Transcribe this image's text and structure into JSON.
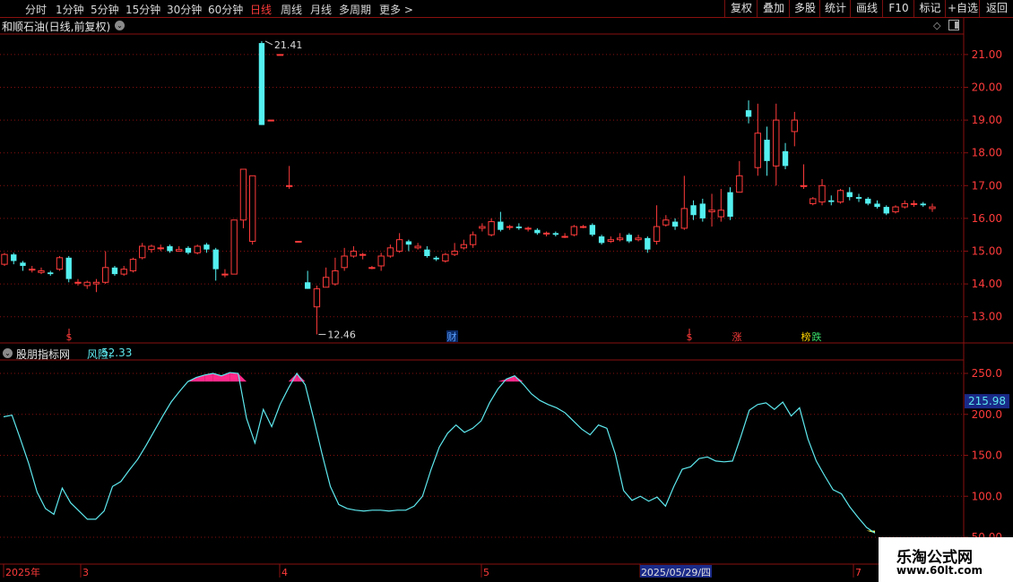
{
  "toolbar": {
    "timeframes": [
      {
        "label": "分时"
      },
      {
        "label": "1分钟"
      },
      {
        "label": "5分钟"
      },
      {
        "label": "15分钟"
      },
      {
        "label": "30分钟"
      },
      {
        "label": "60分钟"
      },
      {
        "label": "日线",
        "active": true
      },
      {
        "label": "周线"
      },
      {
        "label": "月线"
      },
      {
        "label": "多周期"
      },
      {
        "label": "更多 >"
      }
    ],
    "right_buttons": [
      {
        "label": "复权"
      },
      {
        "label": "叠加"
      },
      {
        "label": "多股"
      },
      {
        "label": "统计"
      },
      {
        "label": "画线"
      },
      {
        "label": "F10"
      },
      {
        "label": "标记"
      },
      {
        "label": "+自选"
      },
      {
        "label": "返回"
      }
    ]
  },
  "stock": {
    "title": "和顺石油(日线,前复权)"
  },
  "price_axis": {
    "labels": [
      "21.00",
      "20.00",
      "19.00",
      "18.00",
      "17.00",
      "16.00",
      "15.00",
      "14.00",
      "13.00"
    ]
  },
  "annotations": {
    "high": "21.41",
    "low": "12.46"
  },
  "event_markers": [
    {
      "text": "$",
      "color": "#ff3b3b"
    },
    {
      "text": "财",
      "color": "#5aa0ff"
    },
    {
      "text": "$",
      "color": "#ff3b3b"
    },
    {
      "text": "涨",
      "color": "#ff3b3b"
    },
    {
      "text": "榜",
      "color": "#ffd400"
    },
    {
      "text": "跌",
      "color": "#39e06b"
    }
  ],
  "indicator": {
    "source": "股朋指标网",
    "name": "风险:",
    "value": "52.33",
    "axis_labels": [
      "250.0",
      "200.0",
      "150.0",
      "100.0",
      "50.00"
    ],
    "current": "215.98"
  },
  "date_axis": {
    "labels": [
      "2025年",
      "3",
      "4",
      "5",
      "2025/05/29/四",
      "7"
    ]
  },
  "watermark": {
    "line1": "乐淘公式网",
    "line2": "www.60lt.com"
  },
  "colors": {
    "up": "#ff3b3b",
    "down": "#54f0f0",
    "grid": "#8a1010",
    "line": "#5ee8ee",
    "fill": "#ff2a8a"
  },
  "chart_data": {
    "type": "candlestick",
    "ylim": [
      12.2,
      21.6
    ],
    "candles": [
      [
        14.6,
        14.9,
        14.95,
        14.55
      ],
      [
        14.9,
        14.7,
        14.95,
        14.6
      ],
      [
        14.65,
        14.55,
        14.7,
        14.4
      ],
      [
        14.45,
        14.45,
        14.55,
        14.35
      ],
      [
        14.35,
        14.4,
        14.5,
        14.3
      ],
      [
        14.35,
        14.3,
        14.4,
        14.25
      ],
      [
        14.45,
        14.8,
        14.85,
        14.4
      ],
      [
        14.8,
        14.15,
        14.85,
        14.05
      ],
      [
        14.05,
        14.05,
        14.15,
        13.95
      ],
      [
        13.95,
        14.05,
        14.1,
        13.85
      ],
      [
        14.0,
        14.05,
        14.15,
        13.75
      ],
      [
        14.05,
        14.5,
        15.0,
        14.0
      ],
      [
        14.5,
        14.3,
        14.55,
        14.25
      ],
      [
        14.3,
        14.45,
        14.55,
        14.25
      ],
      [
        14.4,
        14.75,
        14.8,
        14.35
      ],
      [
        14.8,
        15.15,
        15.25,
        14.75
      ],
      [
        15.05,
        15.15,
        15.2,
        14.95
      ],
      [
        15.1,
        15.1,
        15.2,
        15.0
      ],
      [
        15.15,
        15.0,
        15.2,
        14.95
      ],
      [
        15.0,
        15.05,
        15.15,
        15.0
      ],
      [
        15.1,
        14.95,
        15.15,
        14.9
      ],
      [
        14.95,
        15.15,
        15.2,
        14.9
      ],
      [
        15.2,
        15.05,
        15.25,
        14.95
      ],
      [
        15.05,
        14.45,
        15.1,
        14.1
      ],
      [
        14.3,
        14.3,
        14.45,
        14.2
      ],
      [
        14.3,
        15.95,
        15.95,
        14.3
      ],
      [
        15.95,
        17.5,
        17.5,
        15.7
      ],
      [
        15.3,
        17.3,
        17.3,
        15.2
      ],
      [
        21.35,
        18.85,
        21.41,
        18.85
      ],
      [
        19.0,
        19.0,
        19.0,
        19.0
      ],
      [
        21.0,
        21.0,
        21.0,
        21.0
      ],
      [
        17.0,
        17.0,
        17.6,
        16.9
      ],
      [
        15.3,
        15.3,
        15.3,
        15.3
      ],
      [
        14.05,
        13.85,
        14.4,
        13.85
      ],
      [
        13.3,
        13.85,
        13.95,
        12.46
      ],
      [
        13.9,
        14.2,
        14.5,
        13.9
      ],
      [
        14.0,
        14.4,
        14.8,
        13.95
      ],
      [
        14.5,
        14.85,
        15.1,
        14.4
      ],
      [
        14.85,
        15.0,
        15.15,
        14.8
      ],
      [
        14.9,
        14.9,
        14.95,
        14.75
      ],
      [
        14.5,
        14.5,
        14.55,
        14.45
      ],
      [
        14.55,
        14.85,
        14.95,
        14.4
      ],
      [
        14.85,
        15.1,
        15.2,
        14.8
      ],
      [
        15.0,
        15.35,
        15.55,
        14.95
      ],
      [
        15.3,
        15.2,
        15.35,
        15.0
      ],
      [
        15.1,
        15.15,
        15.25,
        15.05
      ],
      [
        15.05,
        14.85,
        15.15,
        14.8
      ],
      [
        14.8,
        14.75,
        14.85,
        14.7
      ],
      [
        14.7,
        14.9,
        14.95,
        14.65
      ],
      [
        14.9,
        15.0,
        15.25,
        14.85
      ],
      [
        15.1,
        15.2,
        15.35,
        15.05
      ],
      [
        15.2,
        15.5,
        15.6,
        15.1
      ],
      [
        15.7,
        15.75,
        15.85,
        15.6
      ],
      [
        15.5,
        15.9,
        16.0,
        15.45
      ],
      [
        15.9,
        15.65,
        16.2,
        15.6
      ],
      [
        15.75,
        15.75,
        15.8,
        15.65
      ],
      [
        15.75,
        15.7,
        15.85,
        15.65
      ],
      [
        15.7,
        15.7,
        15.75,
        15.6
      ],
      [
        15.65,
        15.55,
        15.7,
        15.5
      ],
      [
        15.55,
        15.55,
        15.6,
        15.45
      ],
      [
        15.55,
        15.5,
        15.6,
        15.45
      ],
      [
        15.45,
        15.45,
        15.55,
        15.4
      ],
      [
        15.5,
        15.75,
        15.8,
        15.45
      ],
      [
        15.75,
        15.75,
        15.8,
        15.7
      ],
      [
        15.8,
        15.5,
        15.85,
        15.45
      ],
      [
        15.45,
        15.25,
        15.5,
        15.2
      ],
      [
        15.3,
        15.35,
        15.45,
        15.25
      ],
      [
        15.35,
        15.4,
        15.55,
        15.3
      ],
      [
        15.5,
        15.3,
        15.55,
        15.25
      ],
      [
        15.35,
        15.4,
        15.5,
        15.3
      ],
      [
        15.4,
        15.05,
        15.45,
        14.95
      ],
      [
        15.3,
        15.75,
        16.4,
        15.2
      ],
      [
        15.8,
        15.95,
        16.1,
        15.75
      ],
      [
        15.9,
        15.75,
        16.0,
        15.65
      ],
      [
        15.7,
        16.3,
        17.3,
        15.65
      ],
      [
        16.4,
        16.1,
        16.55,
        15.95
      ],
      [
        16.45,
        16.0,
        16.6,
        15.9
      ],
      [
        16.2,
        16.25,
        16.75,
        15.75
      ],
      [
        16.05,
        16.25,
        16.9,
        15.9
      ],
      [
        16.8,
        16.05,
        16.95,
        15.95
      ],
      [
        16.8,
        17.3,
        17.75,
        16.8
      ],
      [
        19.3,
        19.1,
        19.6,
        18.9
      ],
      [
        17.55,
        18.6,
        19.5,
        17.3
      ],
      [
        18.4,
        17.75,
        18.8,
        17.3
      ],
      [
        17.6,
        19.0,
        19.5,
        17.0
      ],
      [
        18.05,
        17.6,
        18.3,
        17.5
      ],
      [
        18.65,
        19.0,
        19.25,
        18.2
      ],
      [
        17.0,
        17.0,
        17.65,
        16.9
      ],
      [
        16.45,
        16.6,
        16.65,
        16.4
      ],
      [
        16.5,
        17.0,
        17.2,
        16.4
      ],
      [
        16.55,
        16.5,
        16.7,
        16.4
      ],
      [
        16.5,
        16.85,
        16.9,
        16.45
      ],
      [
        16.8,
        16.65,
        16.95,
        16.55
      ],
      [
        16.65,
        16.6,
        16.75,
        16.5
      ],
      [
        16.6,
        16.45,
        16.65,
        16.4
      ],
      [
        16.45,
        16.35,
        16.55,
        16.3
      ],
      [
        16.35,
        16.15,
        16.4,
        16.1
      ],
      [
        16.2,
        16.35,
        16.4,
        16.15
      ],
      [
        16.35,
        16.45,
        16.55,
        16.3
      ],
      [
        16.45,
        16.45,
        16.55,
        16.35
      ],
      [
        16.45,
        16.4,
        16.5,
        16.35
      ],
      [
        16.3,
        16.35,
        16.45,
        16.2
      ]
    ],
    "risk": {
      "ylim": [
        50,
        250
      ],
      "values": [
        197,
        199,
        170,
        140,
        105,
        85,
        78,
        110,
        92,
        82,
        72,
        72,
        82,
        112,
        118,
        132,
        145,
        162,
        180,
        198,
        215,
        228,
        240,
        245,
        248,
        250,
        247,
        251,
        250,
        195,
        165,
        206,
        185,
        212,
        232,
        250,
        236,
        195,
        152,
        112,
        90,
        85,
        83,
        82,
        83,
        83,
        82,
        83,
        83,
        88,
        100,
        132,
        160,
        177,
        187,
        178,
        183,
        192,
        214,
        231,
        243,
        247,
        237,
        225,
        217,
        212,
        208,
        202,
        192,
        182,
        175,
        187,
        183,
        152,
        107,
        95,
        100,
        94,
        99,
        88,
        112,
        133,
        136,
        146,
        148,
        143,
        142,
        143,
        173,
        205,
        212,
        214,
        206,
        215,
        198,
        208,
        170,
        143,
        125,
        108,
        103,
        87,
        74,
        62,
        55
      ]
    }
  }
}
